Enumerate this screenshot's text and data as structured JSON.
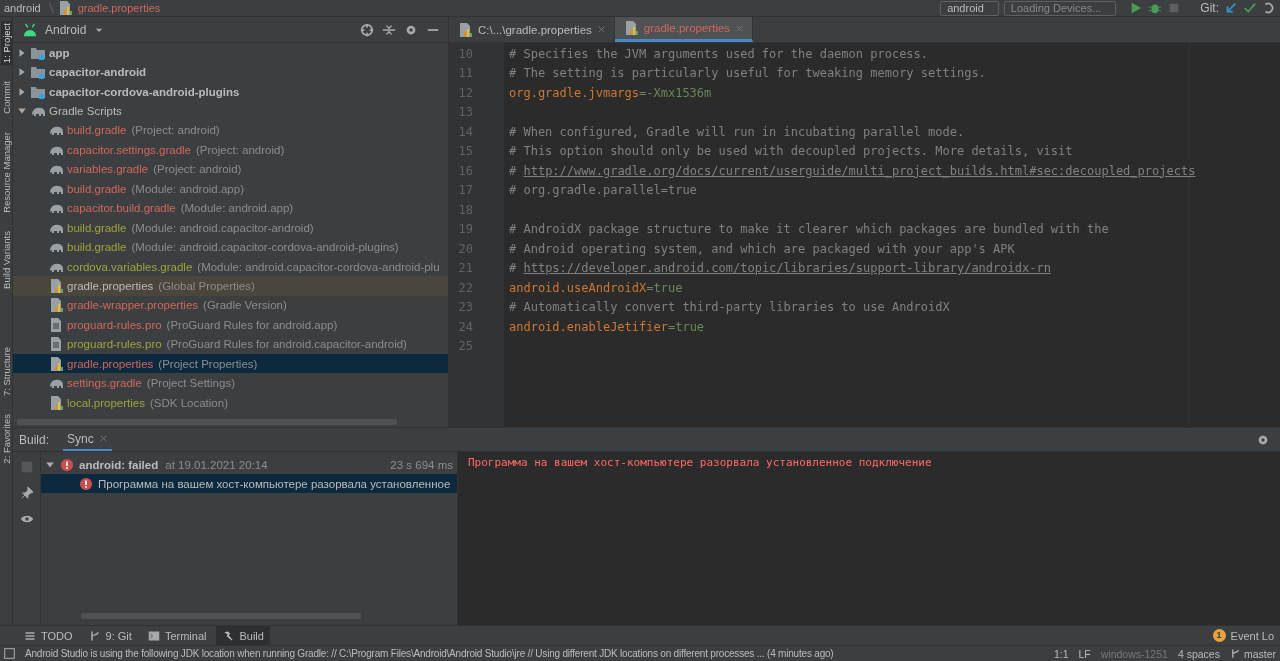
{
  "nav_bar": {
    "breadcrumbs": [
      {
        "label": "android",
        "kind": "module",
        "color": "#bbbbbb"
      },
      {
        "label": "gradle.properties",
        "kind": "properties",
        "color": "#d1675a"
      }
    ],
    "run_config": "android",
    "device": "Loading Devices...",
    "git_label": "Git:"
  },
  "side_tabs": [
    {
      "label": "1: Project",
      "selected": true
    },
    {
      "label": "Commit",
      "selected": false
    },
    {
      "label": "Resource Manager",
      "selected": false
    },
    {
      "label": "Build Variants",
      "selected": false
    },
    {
      "label": "7: Structure",
      "selected": false
    },
    {
      "label": "2: Favorites",
      "selected": false
    }
  ],
  "project_panel": {
    "view": "Android",
    "tree": [
      {
        "name": "app",
        "kind": "folder",
        "color": "#bbbbbb",
        "expanded": false,
        "selected": false,
        "highlighted": false
      },
      {
        "name": "capacitor-android",
        "kind": "folder",
        "color": "#bbbbbb",
        "expanded": false,
        "selected": false,
        "highlighted": false
      },
      {
        "name": "capacitor-cordova-android-plugins",
        "kind": "folder",
        "color": "#bbbbbb",
        "expanded": false,
        "selected": false,
        "highlighted": false
      },
      {
        "name": "Gradle Scripts",
        "kind": "gradle",
        "color": "#bbbbbb",
        "expanded": true,
        "selected": false,
        "highlighted": false,
        "children": [
          {
            "name": "build.gradle",
            "detail": "(Project: android)",
            "kind": "gradle",
            "color": "#d1675a",
            "selected": false,
            "highlighted": false
          },
          {
            "name": "capacitor.settings.gradle",
            "detail": "(Project: android)",
            "kind": "gradle",
            "color": "#d1675a",
            "selected": false,
            "highlighted": false
          },
          {
            "name": "variables.gradle",
            "detail": "(Project: android)",
            "kind": "gradle",
            "color": "#d1675a",
            "selected": false,
            "highlighted": false
          },
          {
            "name": "build.gradle",
            "detail": "(Module: android.app)",
            "kind": "gradle",
            "color": "#d1675a",
            "selected": false,
            "highlighted": false
          },
          {
            "name": "capacitor.build.gradle",
            "detail": "(Module: android.app)",
            "kind": "gradle",
            "color": "#d1675a",
            "selected": false,
            "highlighted": false
          },
          {
            "name": "build.gradle",
            "detail": "(Module: android.capacitor-android)",
            "kind": "gradle",
            "color": "#a3a339",
            "selected": false,
            "highlighted": false
          },
          {
            "name": "build.gradle",
            "detail": "(Module: android.capacitor-cordova-android-plugins)",
            "kind": "gradle",
            "color": "#a3a339",
            "selected": false,
            "highlighted": false
          },
          {
            "name": "cordova.variables.gradle",
            "detail": "(Module: android.capacitor-cordova-android-plu",
            "kind": "gradle",
            "color": "#a3a339",
            "selected": false,
            "highlighted": false
          },
          {
            "name": "gradle.properties",
            "detail": "(Global Properties)",
            "kind": "properties",
            "color": "#bbbbbb",
            "selected": false,
            "highlighted": true
          },
          {
            "name": "gradle-wrapper.properties",
            "detail": "(Gradle Version)",
            "kind": "properties",
            "color": "#d1675a",
            "selected": false,
            "highlighted": false
          },
          {
            "name": "proguard-rules.pro",
            "detail": "(ProGuard Rules for android.app)",
            "kind": "text",
            "color": "#d1675a",
            "selected": false,
            "highlighted": false
          },
          {
            "name": "proguard-rules.pro",
            "detail": "(ProGuard Rules for android.capacitor-android)",
            "kind": "text",
            "color": "#a3a339",
            "selected": false,
            "highlighted": false
          },
          {
            "name": "gradle.properties",
            "detail": "(Project Properties)",
            "kind": "properties",
            "color": "#d1675a",
            "selected": true,
            "highlighted": false
          },
          {
            "name": "settings.gradle",
            "detail": "(Project Settings)",
            "kind": "gradle",
            "color": "#d1675a",
            "selected": false,
            "highlighted": false
          },
          {
            "name": "local.properties",
            "detail": "(SDK Location)",
            "kind": "properties",
            "color": "#a3a339",
            "selected": false,
            "highlighted": false
          }
        ]
      }
    ]
  },
  "editor": {
    "tabs": [
      {
        "label": "C:\\...\\gradle.properties",
        "color": "#bbbbbb",
        "selected": false
      },
      {
        "label": "gradle.properties",
        "color": "#d1675a",
        "selected": true
      }
    ],
    "lines": [
      {
        "number": "10",
        "tokens": [
          {
            "kind": "comment",
            "text": "# Specifies the JVM arguments used for the daemon process."
          }
        ]
      },
      {
        "number": "11",
        "tokens": [
          {
            "kind": "comment",
            "text": "# The setting is particularly useful for tweaking memory settings."
          }
        ]
      },
      {
        "number": "12",
        "tokens": [
          {
            "kind": "key",
            "text": "org.gradle.jvmargs"
          },
          {
            "kind": "value",
            "text": "=-Xmx1536m"
          }
        ]
      },
      {
        "number": "13"
      },
      {
        "number": "14",
        "tokens": [
          {
            "kind": "comment",
            "text": "# When configured, Gradle will run in incubating parallel mode."
          }
        ]
      },
      {
        "number": "15",
        "tokens": [
          {
            "kind": "comment",
            "text": "# This option should only be used with decoupled projects. More details, visit"
          }
        ]
      },
      {
        "number": "16",
        "tokens": [
          {
            "kind": "comment",
            "text": "#"
          },
          {
            "kind": "link",
            "text": "http://www.gradle.org/docs/current/userguide/multi_project_builds.html#sec:decoupled_projects"
          }
        ]
      },
      {
        "number": "17",
        "tokens": [
          {
            "kind": "comment",
            "text": "# org.gradle.parallel=true"
          }
        ]
      },
      {
        "number": "18"
      },
      {
        "number": "19",
        "tokens": [
          {
            "kind": "comment",
            "text": "# AndroidX package structure to make it clearer which packages are bundled with the"
          }
        ]
      },
      {
        "number": "20",
        "tokens": [
          {
            "kind": "comment",
            "text": "# Android operating system, and which are packaged with your app's APK"
          }
        ]
      },
      {
        "number": "21",
        "tokens": [
          {
            "kind": "comment",
            "text": "#"
          },
          {
            "kind": "link",
            "text": "https://developer.android.com/topic/libraries/support-library/androidx-rn"
          }
        ]
      },
      {
        "number": "22",
        "tokens": [
          {
            "kind": "key",
            "text": "android.useAndroidX"
          },
          {
            "kind": "value",
            "text": "=true"
          }
        ]
      },
      {
        "number": "23",
        "tokens": [
          {
            "kind": "comment",
            "text": "# Automatically convert third-party libraries to use AndroidX"
          }
        ]
      },
      {
        "number": "24",
        "tokens": [
          {
            "kind": "key",
            "text": "android.enableJetifier"
          },
          {
            "kind": "value",
            "text": "=true"
          }
        ]
      },
      {
        "number": "25"
      }
    ]
  },
  "build_panel": {
    "label": "Build:",
    "tabs": [
      {
        "label": "Sync",
        "selected": true
      }
    ],
    "tree": [
      {
        "title": "android: failed",
        "timestamp": "at 19.01.2021 20:14",
        "duration": "23 s 694 ms",
        "expanded": true,
        "selected": false,
        "children": [
          {
            "title": "Программа на вашем хост-компьютере разорвала установленное",
            "selected": true
          }
        ]
      }
    ],
    "console": "Программа на вашем хост-компьютере разорвала установленное подключение"
  },
  "tool_tabs": [
    {
      "label": "TODO",
      "kind": "list",
      "selected": false
    },
    {
      "label": "9: Git",
      "kind": "branch",
      "selected": false
    },
    {
      "label": "Terminal",
      "kind": "terminal",
      "selected": false
    },
    {
      "label": "Build",
      "kind": "hammer",
      "selected": true
    }
  ],
  "event_log": {
    "count": "1",
    "label": "Event Lo"
  },
  "status_bar": {
    "message": "Android Studio is using the following JDK location when running Gradle: // C:\\Program Files\\Android\\Android Studio\\jre // Using different JDK locations on different processes ... (4 minutes ago)",
    "position": "1:1",
    "line_ending": "LF",
    "encoding": "windows-1251",
    "indent": "4 spaces",
    "branch": "master"
  }
}
